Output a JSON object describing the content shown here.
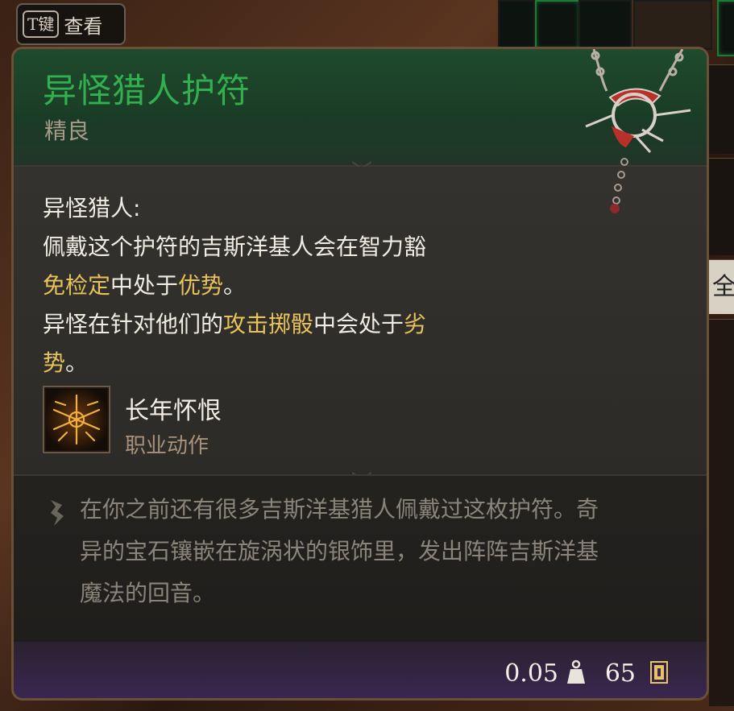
{
  "key_hint": {
    "key": "T键",
    "label": "查看"
  },
  "side_panel": {
    "partial_text": "全"
  },
  "item": {
    "name": "异怪猎人护符",
    "rarity": "精良"
  },
  "description": {
    "heading": "异怪猎人:",
    "line1": "佩戴这个护符的吉斯洋基人会在智力豁",
    "line2_hl": "免检定",
    "line2_rest": "中处于",
    "line2_hl2": "优势",
    "line2_end": "。",
    "line3_a": "异怪在针对他们的",
    "line3_hl": "攻击掷骰",
    "line3_b": "中会处于",
    "line3_hl2": "劣",
    "line4_hl": "势",
    "line4_end": "。"
  },
  "action": {
    "name": "长年怀恨",
    "type": "职业动作",
    "icon": "class-action-icon"
  },
  "lore": {
    "line1": "在你之前还有很多吉斯洋基猎人佩戴过这枚护符。奇",
    "line2": "异的宝石镶嵌在旋涡状的银饰里，发出阵阵吉斯洋基",
    "line3": "魔法的回音。"
  },
  "footer": {
    "weight": "0.05",
    "value": "65",
    "weight_icon": "weight-icon",
    "gold_icon": "gold-icon"
  },
  "colors": {
    "rarity_green": "#33b04e",
    "highlight": "#e8c25a",
    "lore_text": "#8a847a",
    "border": "#6b5038"
  }
}
